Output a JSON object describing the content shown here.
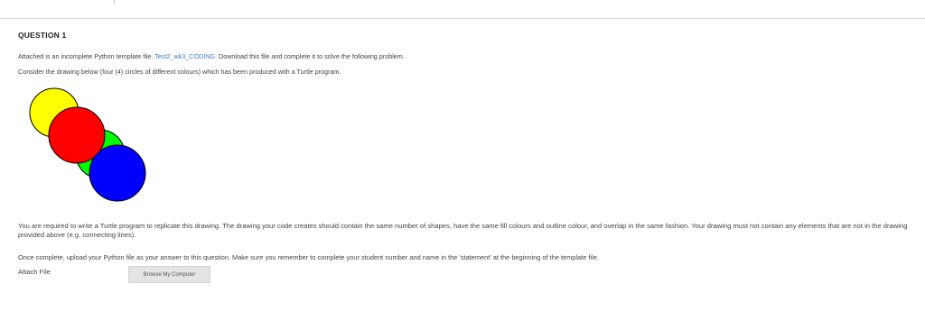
{
  "question": {
    "title": "QUESTION 1",
    "intro_before_link": "Attached is an incomplete Python template file.",
    "file_link": "Test2_wk3_CODING.",
    "intro_after_link": "Download this file and complete it to solve the following problem.",
    "consider": "Consider the drawing below (four (4) circles of different colours) which has been produced with a Turtle program.",
    "requirements": "You are required to write a Turtle program to replicate this drawing.  The drawing your code creates should contain the same number of shapes, have the same fill colours and outline colour, and overlap in the same fashion.  Your drawing must not contain any elements that are not in the drawing provided above (e.g. connecting lines).",
    "once_complete": "Once complete, upload your Python file as your answer to this question.  Make sure you remember to complete your student number and name in the 'statement' at the beginning of the template file.",
    "attach_label": "Attach File",
    "browse_button": "Browse My Computer"
  },
  "drawing": {
    "outline_color": "#000000",
    "circles": [
      {
        "name": "yellow-circle",
        "fill": "#ffff00"
      },
      {
        "name": "green-circle",
        "fill": "#00ff00"
      },
      {
        "name": "red-circle",
        "fill": "#ff0000"
      },
      {
        "name": "blue-circle",
        "fill": "#0000ff"
      }
    ]
  }
}
